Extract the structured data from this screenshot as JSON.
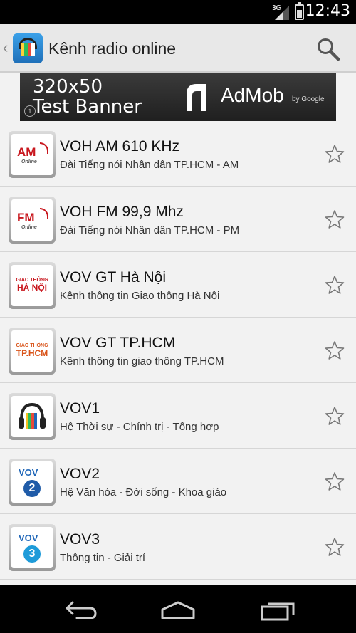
{
  "status_bar": {
    "network": "3G",
    "time": "12:43"
  },
  "action_bar": {
    "title": "Kênh radio online",
    "icons": {
      "app": "radio-app-icon",
      "search": "search-icon",
      "up": "chevron-left-icon"
    }
  },
  "ad": {
    "text_line1": "320x50",
    "text_line2": "Test Banner",
    "brand": "AdMob",
    "by": "by Google"
  },
  "stations": [
    {
      "name": "VOH AM 610 KHz",
      "desc": "Đài Tiếng nói Nhân dân TP.HCM - AM",
      "logo": "am",
      "logo_main": "AM",
      "logo_sub": "Online"
    },
    {
      "name": "VOH FM 99,9 Mhz",
      "desc": "Đài Tiếng nói Nhân dân TP.HCM - PM",
      "logo": "fm",
      "logo_main": "FM",
      "logo_sub": "Online"
    },
    {
      "name": "VOV GT Hà Nội",
      "desc": "Kênh thông tin Giao thông Hà Nội",
      "logo": "gt-hn",
      "logo_main": "HÀ NỘI",
      "logo_sub": "GIAO THÔNG"
    },
    {
      "name": "VOV GT TP.HCM",
      "desc": "Kênh thông tin giao thông TP.HCM",
      "logo": "gt-hcm",
      "logo_main": "TP.HCM",
      "logo_sub": "GIAO THÔNG"
    },
    {
      "name": "VOV1",
      "desc": "Hệ Thời sự - Chính trị - Tổng hợp",
      "logo": "headphones",
      "logo_main": "",
      "logo_sub": ""
    },
    {
      "name": "VOV2",
      "desc": "Hệ Văn hóa - Đời sống - Khoa giáo",
      "logo": "vov2",
      "logo_main": "VOV",
      "logo_sub": "2"
    },
    {
      "name": "VOV3",
      "desc": "Thông tin - Giải trí",
      "logo": "vov3",
      "logo_main": "VOV",
      "logo_sub": "3"
    }
  ],
  "nav_bar": {
    "icons": [
      "back-icon",
      "home-icon",
      "recents-icon"
    ]
  },
  "colors": {
    "action_bar": "#e8e8e8",
    "list_bg": "#f2f2f2",
    "logo_red": "#c8161d",
    "vov_blue": "#1f66b8"
  }
}
